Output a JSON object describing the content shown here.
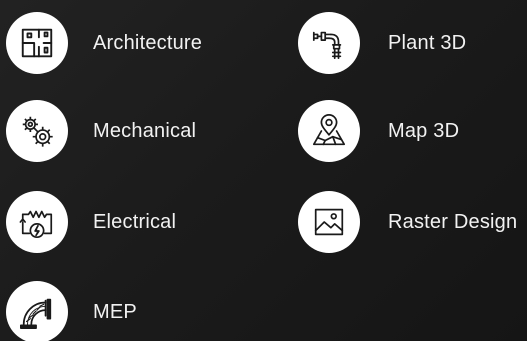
{
  "toolsets": [
    {
      "label": "Architecture",
      "icon": "floor-plan-icon"
    },
    {
      "label": "Mechanical",
      "icon": "gears-icon"
    },
    {
      "label": "Electrical",
      "icon": "circuit-icon"
    },
    {
      "label": "MEP",
      "icon": "duct-elbow-icon"
    },
    {
      "label": "Plant 3D",
      "icon": "valve-pipe-icon"
    },
    {
      "label": "Map 3D",
      "icon": "map-pin-icon"
    },
    {
      "label": "Raster Design",
      "icon": "image-icon"
    }
  ],
  "colors": {
    "background": "#1e1e1e",
    "icon_circle": "#ffffff",
    "icon_stroke": "#1a1a1a",
    "label": "#f2f2f2"
  }
}
